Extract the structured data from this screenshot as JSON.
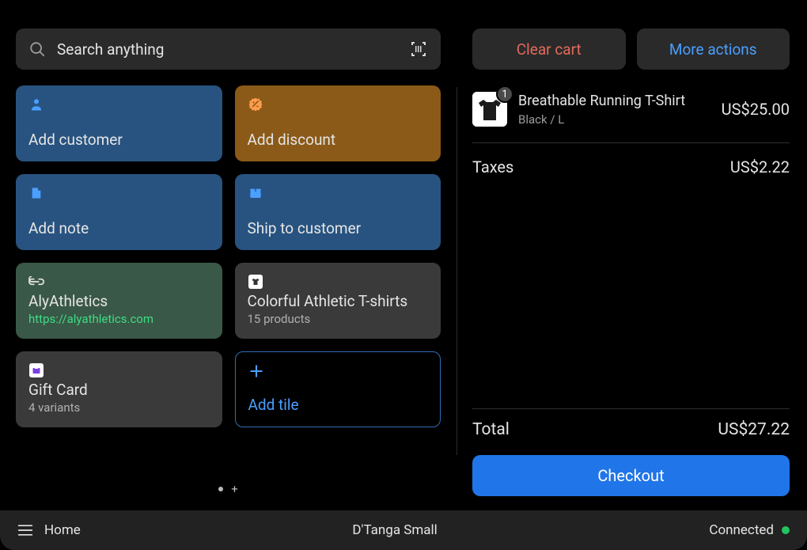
{
  "search": {
    "placeholder": "Search anything"
  },
  "tiles": [
    {
      "title": "Add customer"
    },
    {
      "title": "Add discount"
    },
    {
      "title": "Add note"
    },
    {
      "title": "Ship to customer"
    },
    {
      "title": "AlyAthletics",
      "sub": "https://alyathletics.com"
    },
    {
      "title": "Colorful Athletic T-shirts",
      "sub": "15 products"
    },
    {
      "title": "Gift Card",
      "sub": "4 variants"
    },
    {
      "title": "Add tile"
    }
  ],
  "actions": {
    "clear": "Clear cart",
    "more": "More actions",
    "checkout": "Checkout"
  },
  "cart": {
    "items": [
      {
        "qty": "1",
        "title": "Breathable Running T-Shirt",
        "sub": "Black / L",
        "price": "US$25.00"
      }
    ],
    "taxes_label": "Taxes",
    "taxes_value": "US$2.22",
    "total_label": "Total",
    "total_value": "US$27.22"
  },
  "footer": {
    "home": "Home",
    "center": "D'Tanga Small",
    "connected": "Connected"
  }
}
